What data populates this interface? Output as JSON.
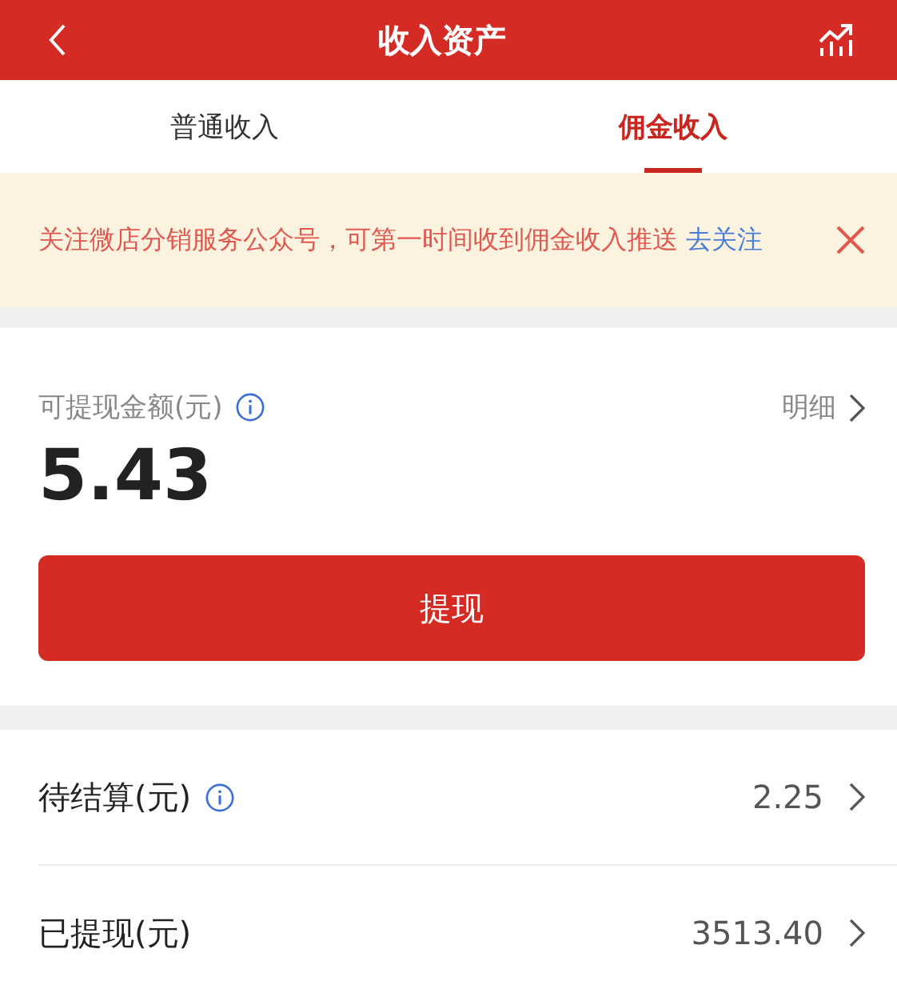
{
  "header": {
    "title": "收入资产"
  },
  "tabs": [
    {
      "label": "普通收入",
      "selected": false
    },
    {
      "label": "佣金收入",
      "selected": true
    }
  ],
  "notice": {
    "text": "关注微店分销服务公众号，可第一时间收到佣金收入推送",
    "link": "去关注"
  },
  "balance": {
    "label": "可提现金额(元)",
    "info": true,
    "detail_link": "明细",
    "amount": "5.43",
    "button": "提现"
  },
  "rows": [
    {
      "label": "待结算(元)",
      "info": true,
      "value": "2.25"
    },
    {
      "label": "已提现(元)",
      "info": false,
      "value": "3513.40"
    }
  ]
}
